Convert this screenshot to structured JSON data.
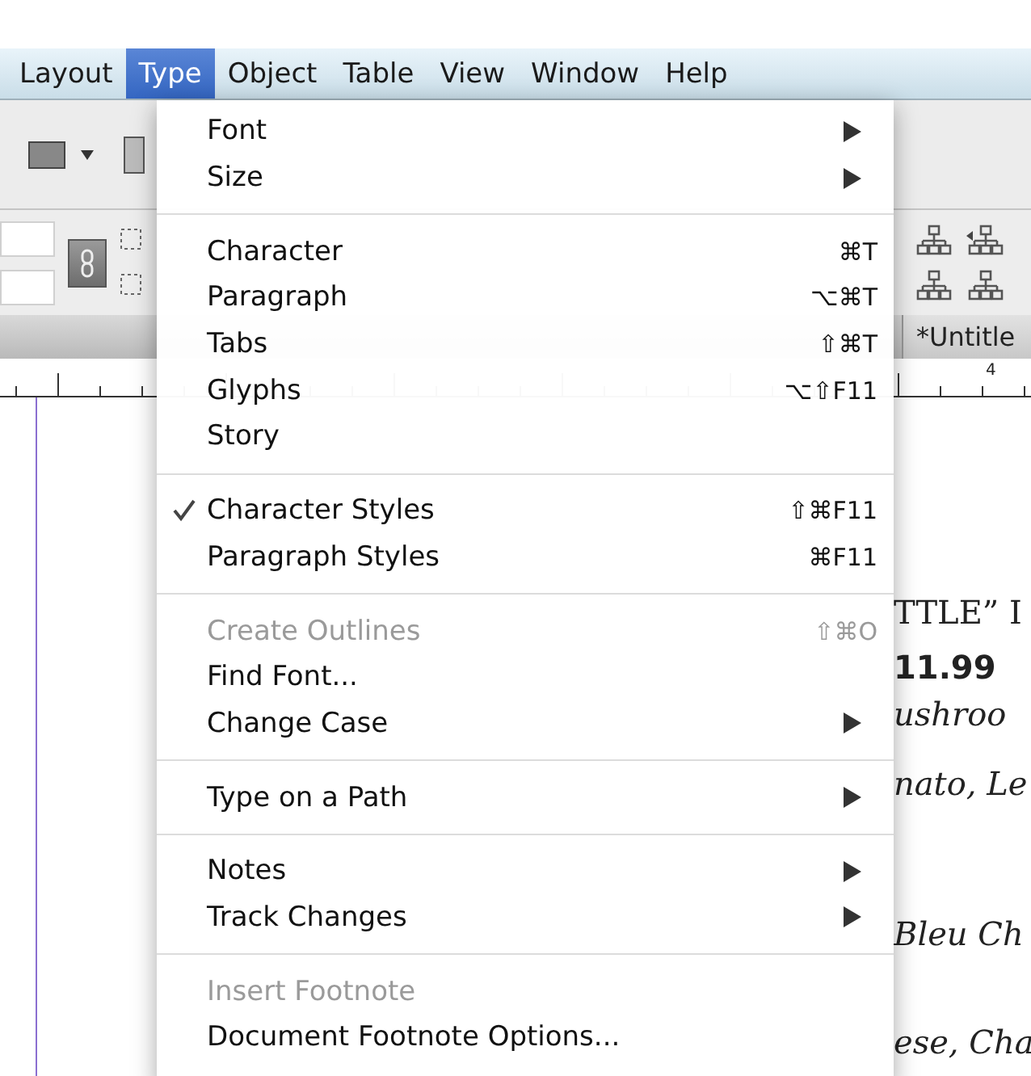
{
  "menu_bar": [
    {
      "label": "Layout",
      "selected": false
    },
    {
      "label": "Type",
      "selected": true
    },
    {
      "label": "Object",
      "selected": false
    },
    {
      "label": "Table",
      "selected": false
    },
    {
      "label": "View",
      "selected": false
    },
    {
      "label": "Window",
      "selected": false
    },
    {
      "label": "Help",
      "selected": false
    }
  ],
  "document_tab": {
    "title": "*Untitle"
  },
  "ruler": {
    "label": "4"
  },
  "document_text": [
    {
      "text": "TTLE” I",
      "kind": "roman"
    },
    {
      "text": "11.99",
      "kind": "bold"
    },
    {
      "text": "ushroo",
      "kind": "italic"
    },
    {
      "text": "nato, Le",
      "kind": "italic"
    },
    {
      "text": "Bleu Ch",
      "kind": "italic"
    },
    {
      "text": "ese, Cha",
      "kind": "italic"
    }
  ],
  "type_menu": {
    "sections": [
      [
        {
          "label": "Font",
          "submenu": true,
          "checked": false,
          "disabled": false
        },
        {
          "label": "Size",
          "submenu": true,
          "checked": false,
          "disabled": false
        }
      ],
      [
        {
          "label": "Character",
          "shortcut": "⌘T",
          "submenu": false,
          "checked": false,
          "disabled": false
        },
        {
          "label": "Paragraph",
          "shortcut": "⌥⌘T",
          "submenu": false,
          "checked": false,
          "disabled": false
        },
        {
          "label": "Tabs",
          "shortcut": "⇧⌘T",
          "submenu": false,
          "checked": false,
          "disabled": false
        },
        {
          "label": "Glyphs",
          "shortcut": "⌥⇧F11",
          "submenu": false,
          "checked": false,
          "disabled": false
        },
        {
          "label": "Story",
          "submenu": false,
          "checked": false,
          "disabled": false
        }
      ],
      [
        {
          "label": "Character Styles",
          "shortcut": "⇧⌘F11",
          "submenu": false,
          "checked": true,
          "disabled": false
        },
        {
          "label": "Paragraph Styles",
          "shortcut": "⌘F11",
          "submenu": false,
          "checked": false,
          "disabled": false
        }
      ],
      [
        {
          "label": "Create Outlines",
          "shortcut": "⇧⌘O",
          "submenu": false,
          "checked": false,
          "disabled": true
        },
        {
          "label": "Find Font...",
          "submenu": false,
          "checked": false,
          "disabled": false
        },
        {
          "label": "Change Case",
          "submenu": true,
          "checked": false,
          "disabled": false
        }
      ],
      [
        {
          "label": "Type on a Path",
          "submenu": true,
          "checked": false,
          "disabled": false
        }
      ],
      [
        {
          "label": "Notes",
          "submenu": true,
          "checked": false,
          "disabled": false
        },
        {
          "label": "Track Changes",
          "submenu": true,
          "checked": false,
          "disabled": false
        }
      ],
      [
        {
          "label": "Insert Footnote",
          "submenu": false,
          "checked": false,
          "disabled": true
        },
        {
          "label": "Document Footnote Options...",
          "submenu": false,
          "checked": false,
          "disabled": false
        }
      ]
    ]
  }
}
